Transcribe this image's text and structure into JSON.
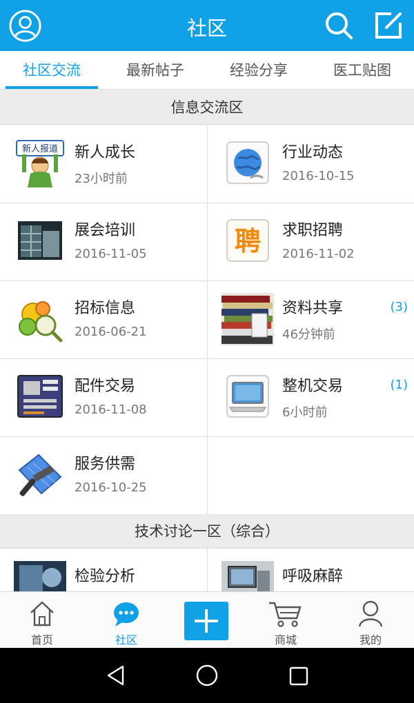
{
  "header": {
    "title": "社区"
  },
  "tabs": [
    {
      "label": "社区交流",
      "active": true
    },
    {
      "label": "最新帖子",
      "active": false
    },
    {
      "label": "经验分享",
      "active": false
    },
    {
      "label": "医工贴图",
      "active": false
    }
  ],
  "section1": {
    "title": "信息交流区",
    "items": [
      {
        "name": "新人成长",
        "time": "23小时前",
        "count": "",
        "thumb_text": "新人报道",
        "icon": "newbie-icon"
      },
      {
        "name": "行业动态",
        "time": "2016-10-15",
        "count": "",
        "icon": "globe-icon"
      },
      {
        "name": "展会培训",
        "time": "2016-11-05",
        "count": "",
        "icon": "building-icon"
      },
      {
        "name": "求职招聘",
        "time": "2016-11-02",
        "count": "",
        "thumb_text": "聘",
        "icon": "recruit-icon"
      },
      {
        "name": "招标信息",
        "time": "2016-06-21",
        "count": "",
        "icon": "bidding-icon"
      },
      {
        "name": "资料共享",
        "time": "46分钟前",
        "count": "(3)",
        "icon": "books-icon"
      },
      {
        "name": "配件交易",
        "time": "2016-11-08",
        "count": "",
        "icon": "motherboard-icon"
      },
      {
        "name": "整机交易",
        "time": "6小时前",
        "count": "(1)",
        "icon": "laptop-icon"
      },
      {
        "name": "服务供需",
        "time": "2016-10-25",
        "count": "",
        "icon": "hammer-icon"
      }
    ]
  },
  "section2": {
    "title": "技术讨论一区（综合）",
    "items": [
      {
        "name": "检验分析",
        "icon": "lab-icon"
      },
      {
        "name": "呼吸麻醉",
        "icon": "ventilator-icon"
      }
    ]
  },
  "bottom_nav": [
    {
      "label": "首页",
      "icon": "home-icon",
      "active": false
    },
    {
      "label": "社区",
      "icon": "chat-icon",
      "active": true
    },
    {
      "label": "",
      "icon": "plus-icon",
      "active": false
    },
    {
      "label": "商城",
      "icon": "cart-icon",
      "active": false
    },
    {
      "label": "我的",
      "icon": "user-icon",
      "active": false
    }
  ],
  "colors": {
    "accent": "#0fa0e6",
    "count": "#0fa0e6"
  }
}
